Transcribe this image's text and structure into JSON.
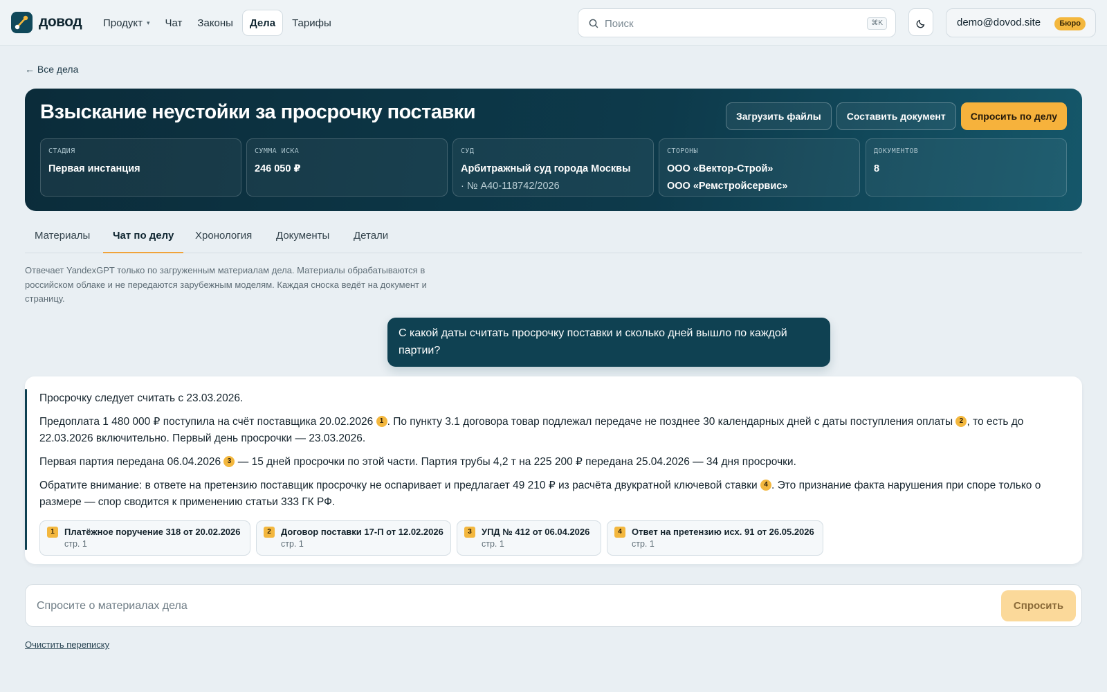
{
  "brand": {
    "name": "довод"
  },
  "nav": {
    "items": [
      {
        "label": "Продукт",
        "has_dropdown": true,
        "active": false
      },
      {
        "label": "Чат",
        "active": false
      },
      {
        "label": "Законы",
        "active": false
      },
      {
        "label": "Дела",
        "active": true
      },
      {
        "label": "Тарифы",
        "active": false
      }
    ]
  },
  "search": {
    "placeholder": "Поиск",
    "shortcut": "⌘K"
  },
  "account": {
    "email": "demo@dovod.site",
    "plan": "Бюро"
  },
  "back_link": "← Все дела",
  "case": {
    "title": "Взыскание неустойки за просрочку поставки",
    "actions": {
      "upload": "Загрузить файлы",
      "compose": "Составить документ",
      "ask": "Спросить по делу"
    },
    "stats": [
      {
        "label": "Стадия",
        "value": "Первая инстанция"
      },
      {
        "label": "Сумма иска",
        "value": "246 050 ₽"
      },
      {
        "label": "Суд",
        "value": "Арбитражный суд города Москвы",
        "sub": "· № А40-118742/2026"
      },
      {
        "label": "Стороны",
        "value": "ООО «Вектор-Строй»",
        "value2": "ООО «Ремстройсервис»"
      },
      {
        "label": "Документов",
        "value": "8"
      }
    ]
  },
  "tabs": [
    {
      "label": "Материалы",
      "active": false
    },
    {
      "label": "Чат по делу",
      "active": true
    },
    {
      "label": "Хронология",
      "active": false
    },
    {
      "label": "Документы",
      "active": false
    },
    {
      "label": "Детали",
      "active": false
    }
  ],
  "disclaimer": "Отвечает YandexGPT только по загруженным материалам дела. Материалы обрабатываются в российском облаке и не передаются зарубежным моделям. Каждая сноска ведёт на документ и страницу.",
  "chat": {
    "question": "С какой даты считать просрочку поставки и сколько дней вышло по каждой партии?",
    "answer": {
      "p1": "Просрочку следует считать с 23.03.2026.",
      "p2a": "Предоплата 1 480 000 ₽ поступила на счёт поставщика 20.02.2026",
      "p2b": ". По пункту 3.1 договора товар подлежал передаче не позднее 30 календарных дней с даты поступления оплаты",
      "p2c": ", то есть до 22.03.2026 включительно. Первый день просрочки — 23.03.2026.",
      "p3a": "Первая партия передана 06.04.2026",
      "p3b": " — 15 дней просрочки по этой части. Партия трубы 4,2 т на 225 200 ₽ передана 25.04.2026 — 34 дня просрочки.",
      "p4a": "Обратите внимание: в ответе на претензию поставщик просрочку не оспаривает и предлагает 49 210 ₽ из расчёта двукратной ключевой ставки",
      "p4b": ". Это признание факта нарушения при споре только о размере — спор сводится к применению статьи 333 ГК РФ.",
      "fn": [
        "1",
        "2",
        "3",
        "4"
      ]
    },
    "sources": [
      {
        "num": "1",
        "title": "Платёжное поручение 318 от 20.02.2026",
        "page": "стр. 1"
      },
      {
        "num": "2",
        "title": "Договор поставки 17-П от 12.02.2026",
        "page": "стр. 1"
      },
      {
        "num": "3",
        "title": "УПД № 412 от 06.04.2026",
        "page": "стр. 1"
      },
      {
        "num": "4",
        "title": "Ответ на претензию исх. 91 от 26.05.2026",
        "page": "стр. 1"
      }
    ]
  },
  "ask": {
    "placeholder": "Спросите о материалах дела",
    "button": "Спросить"
  },
  "clear_link": "Очистить переписку",
  "colors": {
    "accent": "#f6b23c",
    "primary": "#0f4152",
    "background": "#e9eff3"
  }
}
